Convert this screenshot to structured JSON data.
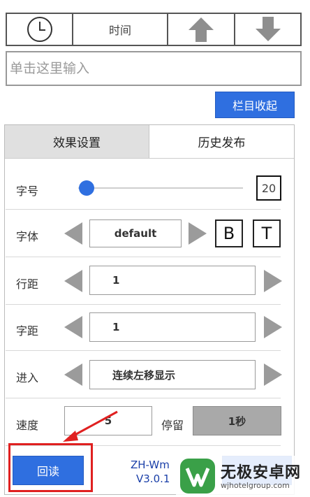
{
  "toolbar": {
    "clock_icon": "clock-icon",
    "time_label": "时间",
    "up_icon": "arrow-up-icon",
    "down_icon": "arrow-down-icon"
  },
  "input": {
    "placeholder": "单击这里输入"
  },
  "collapse_button": "栏目收起",
  "tabs": [
    {
      "label": "效果设置",
      "active": true
    },
    {
      "label": "历史发布",
      "active": false
    }
  ],
  "settings": {
    "font_size": {
      "label": "字号",
      "value": "20",
      "slider_fraction": 0.05
    },
    "font": {
      "label": "字体",
      "value": "default",
      "bold_label": "B",
      "text_label": "T"
    },
    "line_spacing": {
      "label": "行距",
      "value": "1"
    },
    "char_spacing": {
      "label": "字距",
      "value": "1"
    },
    "enter": {
      "label": "进入",
      "value": "连续左移显示"
    },
    "speed": {
      "label": "速度",
      "value": "5"
    },
    "stay": {
      "label": "停留",
      "value": "1秒"
    }
  },
  "footer": {
    "readback_label": "回读",
    "app_name": "ZH-Wm",
    "version": "V3.0.1"
  },
  "watermark": {
    "title": "无极安卓网",
    "url": "wjhotelgroup.com"
  },
  "colors": {
    "accent": "#2f6fe0",
    "highlight": "#e02020",
    "arrow_gray": "#9b9b9b"
  }
}
